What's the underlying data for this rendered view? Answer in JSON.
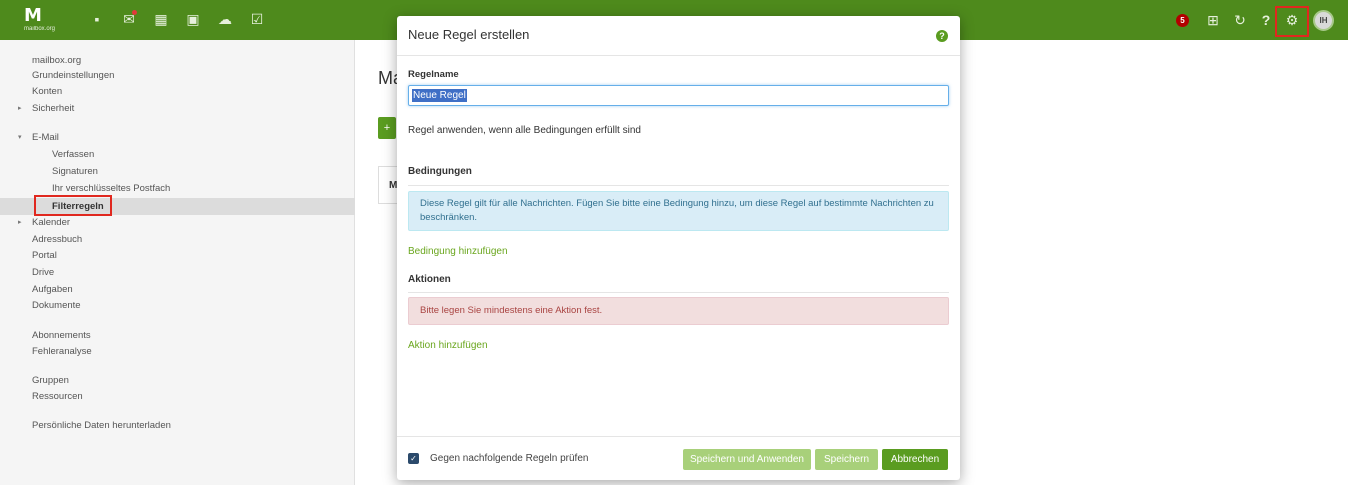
{
  "topbar": {
    "logo": "M",
    "logo_sub": "mailbox.org",
    "apps": [
      {
        "name": "apps-grid-icon",
        "glyph": "▪"
      },
      {
        "name": "mail-icon",
        "glyph": "✉"
      },
      {
        "name": "calendar-icon",
        "glyph": "▦"
      },
      {
        "name": "contacts-icon",
        "glyph": "▣"
      },
      {
        "name": "cloud-icon",
        "glyph": "☁"
      },
      {
        "name": "tasks-icon",
        "glyph": "☑"
      }
    ],
    "badge_count": "5",
    "right_icons": [
      {
        "name": "launcher-grid-icon",
        "glyph": "⊞"
      },
      {
        "name": "refresh-icon",
        "glyph": "↻"
      },
      {
        "name": "help-icon",
        "glyph": "?"
      },
      {
        "name": "gear-icon",
        "glyph": "⚙"
      }
    ],
    "avatar_initials": "IH",
    "colors": {
      "bar": "#4e8a1c",
      "highlight": "#e0281f"
    }
  },
  "sidebar": {
    "items": [
      {
        "label": "mailbox.org"
      },
      {
        "label": "Grundeinstellungen"
      },
      {
        "label": "Konten"
      },
      {
        "label": "Sicherheit",
        "caret": "▸"
      },
      {
        "label": "E-Mail",
        "caret": "▾"
      },
      {
        "label": "Verfassen"
      },
      {
        "label": "Signaturen"
      },
      {
        "label": "Ihr verschlüsseltes Postfach"
      },
      {
        "label": "Filterregeln"
      },
      {
        "label": "Kalender",
        "caret": "▸"
      },
      {
        "label": "Adressbuch"
      },
      {
        "label": "Portal"
      },
      {
        "label": "Drive"
      },
      {
        "label": "Aufgaben"
      },
      {
        "label": "Dokumente"
      },
      {
        "label": "Abonnements"
      },
      {
        "label": "Fehleranalyse"
      },
      {
        "label": "Gruppen"
      },
      {
        "label": "Ressourcen"
      },
      {
        "label": "Persönliche Daten herunterladen"
      }
    ]
  },
  "main": {
    "title_partial": "Ma",
    "add_glyph": "+",
    "card_partial": "M"
  },
  "modal": {
    "title": "Neue Regel erstellen",
    "help_glyph": "?",
    "name_label": "Regelname",
    "name_value": "Neue Regel",
    "apply_text": "Regel anwenden, wenn alle Bedingungen erfüllt sind",
    "conditions_heading": "Bedingungen",
    "conditions_info": "Diese Regel gilt für alle Nachrichten. Fügen Sie bitte eine Bedingung hinzu, um diese Regel auf bestimmte Nachrichten zu beschränken.",
    "add_condition": "Bedingung hinzufügen",
    "actions_heading": "Aktionen",
    "actions_warning": "Bitte legen Sie mindestens eine Aktion fest.",
    "add_action": "Aktion hinzufügen",
    "checkbox_label": "Gegen nachfolgende Regeln prüfen",
    "checkbox_checked": true,
    "buttons": {
      "save_apply": "Speichern und Anwenden",
      "save": "Speichern",
      "cancel": "Abbrechen"
    }
  }
}
